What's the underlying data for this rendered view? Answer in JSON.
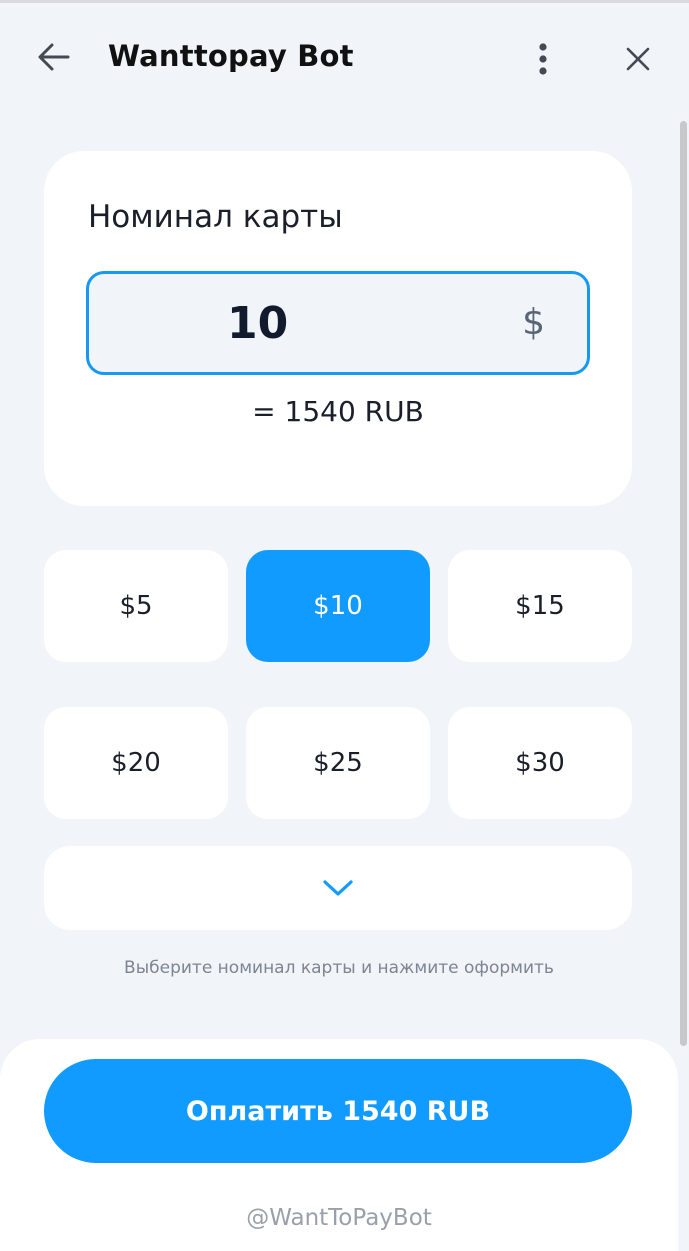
{
  "header": {
    "title": "Wanttopay Bot",
    "back_icon": "arrow-left-icon",
    "menu_icon": "more-vertical-icon",
    "close_icon": "close-icon"
  },
  "card": {
    "label": "Номинал карты",
    "amount_value": "10",
    "currency_symbol": "$",
    "conversion": "= 1540 RUB"
  },
  "presets": [
    {
      "label": "$5",
      "selected": false
    },
    {
      "label": "$10",
      "selected": true
    },
    {
      "label": "$15",
      "selected": false
    },
    {
      "label": "$20",
      "selected": false
    },
    {
      "label": "$25",
      "selected": false
    },
    {
      "label": "$30",
      "selected": false
    }
  ],
  "expand_icon": "chevron-down-icon",
  "hint": "Выберите номинал карты и нажмите оформить",
  "pay_button": "Оплатить 1540 RUB",
  "footer": "@WantToPayBot",
  "colors": {
    "accent": "#129bff",
    "background": "#f1f4f8",
    "surface": "#ffffff"
  }
}
